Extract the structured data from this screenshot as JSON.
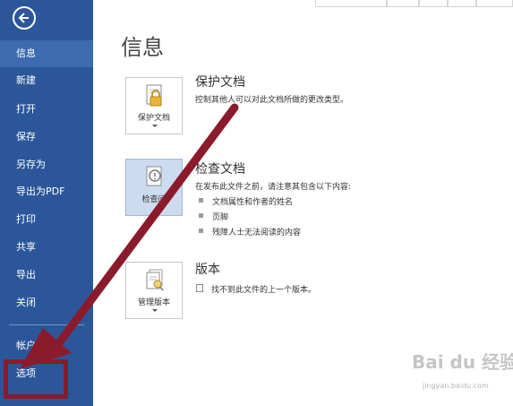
{
  "nav": {
    "back_label": "",
    "items": [
      {
        "label": "信息"
      },
      {
        "label": "新建"
      },
      {
        "label": "打开"
      },
      {
        "label": "保存"
      },
      {
        "label": "另存为"
      },
      {
        "label": "导出为PDF"
      },
      {
        "label": "打印"
      },
      {
        "label": "共享"
      },
      {
        "label": "导出"
      },
      {
        "label": "关闭"
      },
      {
        "label": "帐户"
      },
      {
        "label": "选项"
      }
    ],
    "active_item": "信息"
  },
  "main": {
    "title": "信息",
    "sections": [
      {
        "tile_label": "保护文档",
        "tile_icon": "lock-document-icon",
        "heading": "保护文档",
        "description": "控制其他人可以对此文档所做的更改类型。"
      },
      {
        "tile_label": "检查问",
        "tile_icon": "inspect-document-icon",
        "heading": "检查文档",
        "description": "在发布此文件之前，请注意其包含以下内容:",
        "bullets": [
          "文档属性和作者的姓名",
          "页脚",
          "残障人士无法阅读的内容"
        ]
      },
      {
        "tile_label": "管理版本",
        "tile_icon": "manage-versions-icon",
        "heading": "版本",
        "description": "找不到此文件的上一个版本。"
      }
    ]
  },
  "overlay": {
    "highlight_color": "#8b1a2b",
    "watermark": "Bai du 经验",
    "watermark_sub": "jingyan.baidu.com"
  },
  "colors": {
    "nav_bg": "#2b579a",
    "nav_active": "#3c6bb0",
    "tile_selected": "#cddbf0"
  }
}
